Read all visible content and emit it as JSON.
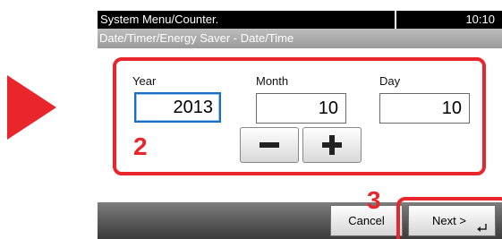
{
  "header": {
    "title": "System Menu/Counter.",
    "time": "10:10",
    "subtitle": "Date/Timer/Energy Saver - Date/Time"
  },
  "fields": {
    "year": {
      "label": "Year",
      "value": "2013"
    },
    "month": {
      "label": "Month",
      "value": "10"
    },
    "day": {
      "label": "Day",
      "value": "10"
    }
  },
  "stepper": {
    "minus_icon": "minus-icon",
    "plus_icon": "plus-icon"
  },
  "footer": {
    "cancel_label": "Cancel",
    "next_label": "Next >",
    "enter_icon": "enter-icon"
  },
  "callouts": {
    "step2": "2",
    "step3": "3"
  },
  "colors": {
    "accent_red": "#e8262b",
    "focus_blue": "#1b6fc2",
    "title_bar": "#000000"
  }
}
